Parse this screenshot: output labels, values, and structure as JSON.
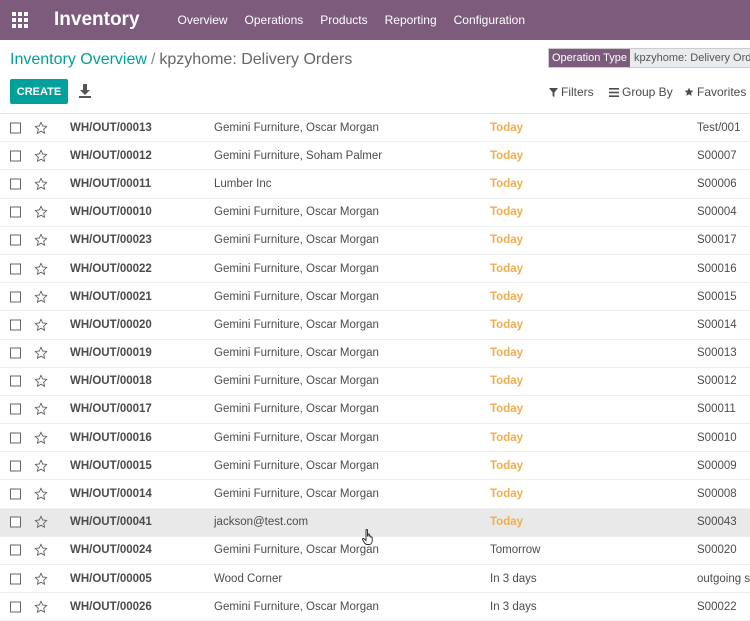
{
  "navbar": {
    "app_name": "Inventory",
    "menu": [
      "Overview",
      "Operations",
      "Products",
      "Reporting",
      "Configuration"
    ]
  },
  "breadcrumb": {
    "parent": "Inventory Overview",
    "separator": "/",
    "current": "kpzyhome: Delivery Orders"
  },
  "search": {
    "facet_label": "Operation Type",
    "facet_value": "kpzyhome: Delivery Orders"
  },
  "toolbar": {
    "create_label": "CREATE",
    "filters_label": "Filters",
    "group_by_label": "Group By",
    "favorites_label": "Favorites"
  },
  "colors": {
    "brand": "#7c5b7c",
    "accent": "#00a09d",
    "today": "#f0ad4e"
  },
  "rows": [
    {
      "reference": "WH/OUT/00013",
      "partner": "Gemini Furniture, Oscar Morgan",
      "scheduled": "Today",
      "origin": "Test/001"
    },
    {
      "reference": "WH/OUT/00012",
      "partner": "Gemini Furniture, Soham Palmer",
      "scheduled": "Today",
      "origin": "S00007"
    },
    {
      "reference": "WH/OUT/00011",
      "partner": "Lumber Inc",
      "scheduled": "Today",
      "origin": "S00006"
    },
    {
      "reference": "WH/OUT/00010",
      "partner": "Gemini Furniture, Oscar Morgan",
      "scheduled": "Today",
      "origin": "S00004"
    },
    {
      "reference": "WH/OUT/00023",
      "partner": "Gemini Furniture, Oscar Morgan",
      "scheduled": "Today",
      "origin": "S00017"
    },
    {
      "reference": "WH/OUT/00022",
      "partner": "Gemini Furniture, Oscar Morgan",
      "scheduled": "Today",
      "origin": "S00016"
    },
    {
      "reference": "WH/OUT/00021",
      "partner": "Gemini Furniture, Oscar Morgan",
      "scheduled": "Today",
      "origin": "S00015"
    },
    {
      "reference": "WH/OUT/00020",
      "partner": "Gemini Furniture, Oscar Morgan",
      "scheduled": "Today",
      "origin": "S00014"
    },
    {
      "reference": "WH/OUT/00019",
      "partner": "Gemini Furniture, Oscar Morgan",
      "scheduled": "Today",
      "origin": "S00013"
    },
    {
      "reference": "WH/OUT/00018",
      "partner": "Gemini Furniture, Oscar Morgan",
      "scheduled": "Today",
      "origin": "S00012"
    },
    {
      "reference": "WH/OUT/00017",
      "partner": "Gemini Furniture, Oscar Morgan",
      "scheduled": "Today",
      "origin": "S00011"
    },
    {
      "reference": "WH/OUT/00016",
      "partner": "Gemini Furniture, Oscar Morgan",
      "scheduled": "Today",
      "origin": "S00010"
    },
    {
      "reference": "WH/OUT/00015",
      "partner": "Gemini Furniture, Oscar Morgan",
      "scheduled": "Today",
      "origin": "S00009"
    },
    {
      "reference": "WH/OUT/00014",
      "partner": "Gemini Furniture, Oscar Morgan",
      "scheduled": "Today",
      "origin": "S00008"
    },
    {
      "reference": "WH/OUT/00041",
      "partner": "jackson@test.com",
      "scheduled": "Today",
      "origin": "S00043",
      "hover": true
    },
    {
      "reference": "WH/OUT/00024",
      "partner": "Gemini Furniture, Oscar Morgan",
      "scheduled": "Tomorrow",
      "origin": "S00020"
    },
    {
      "reference": "WH/OUT/00005",
      "partner": "Wood Corner",
      "scheduled": "In 3 days",
      "origin": "outgoing s"
    },
    {
      "reference": "WH/OUT/00026",
      "partner": "Gemini Furniture, Oscar Morgan",
      "scheduled": "In 3 days",
      "origin": "S00022"
    }
  ]
}
